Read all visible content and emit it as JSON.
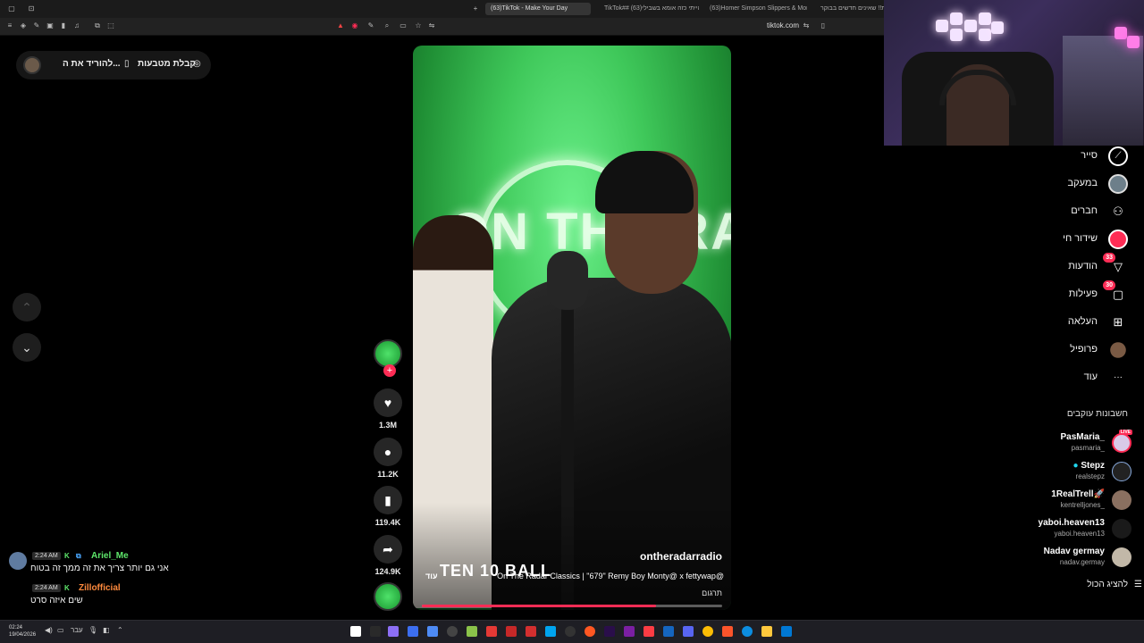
{
  "browser": {
    "tabs": [
      {
        "label": "(63)TikTok - Make Your Day",
        "active": true
      },
      {
        "label": "TikTok## (63)הייתי כזה אומא בשבילי | ",
        "active": false
      },
      {
        "label": "(63)Homer Simpson Slippers & More",
        "active": false
      },
      {
        "label": "חפושיות!! שאינים חדשים בבוקר",
        "active": false
      }
    ],
    "url": "tiktok.com"
  },
  "page": {
    "coins_label": "קבלת מטבעות",
    "download_label": "להוריד את ה...",
    "nav_up": "⌃",
    "nav_down": "⌄"
  },
  "video": {
    "neon_text": "ON THE RADAR",
    "logo": "TEN 10 BALL",
    "author": "ontheradarradio",
    "caption": "On The Radar Classics | \"679\" Remy Boy Monty@ x fettywap@",
    "more": "עוד",
    "translate": "תרגום",
    "progress": 0.78
  },
  "actions": {
    "likes": "1.3M",
    "comments": "11.2K",
    "saves": "119.4K",
    "shares": "124.9K",
    "follow_plus": "+"
  },
  "chat": [
    {
      "time": "2:24 AM",
      "user": "Ariel_Me",
      "message": "אני גם יותר צריך את זה ממך זה בטוח",
      "user_color": "#5ee86b"
    },
    {
      "time": "2:24 AM",
      "user": "Zillofficial",
      "message": "שים איזה סרט",
      "user_color": "#ff8a3d"
    }
  ],
  "sidebar": {
    "items": [
      {
        "label": "סייר",
        "icon": "compass-icon",
        "glyph": "◎"
      },
      {
        "label": "במעקב",
        "icon": "following-avatar-icon",
        "glyph": ""
      },
      {
        "label": "חברים",
        "icon": "friends-icon",
        "glyph": "👥"
      },
      {
        "label": "שידור חי",
        "icon": "live-icon",
        "glyph": ""
      },
      {
        "label": "הודעות",
        "icon": "messages-icon",
        "glyph": "▽",
        "badge": "33"
      },
      {
        "label": "פעילות",
        "icon": "activity-icon",
        "glyph": "▢",
        "badge": "30"
      },
      {
        "label": "העלאה",
        "icon": "upload-icon",
        "glyph": "⊞"
      },
      {
        "label": "פרופיל",
        "icon": "profile-avatar-icon",
        "glyph": ""
      },
      {
        "label": "עוד",
        "icon": "more-icon",
        "glyph": "···"
      }
    ],
    "following_title": "חשבונות עוקבים",
    "accounts": [
      {
        "name": "PasMaria_",
        "handle": "pasmaria_",
        "live": "LIVE"
      },
      {
        "name": "Stepz",
        "handle": "realstepz"
      },
      {
        "name": "1RealTrell🚀",
        "handle": "kentrelljones_"
      },
      {
        "name": "yaboi.heaven13",
        "handle": "yaboi.heaven13"
      },
      {
        "name": "Nadav germay",
        "handle": "nadav.germay"
      }
    ],
    "show_all": "להציג הכול"
  },
  "taskbar": {
    "time": "02:24",
    "date": "19/04/2026",
    "lang": "עבר"
  },
  "colors": {
    "accent": "#fe2c55",
    "green_screen": "#3fc85a"
  }
}
